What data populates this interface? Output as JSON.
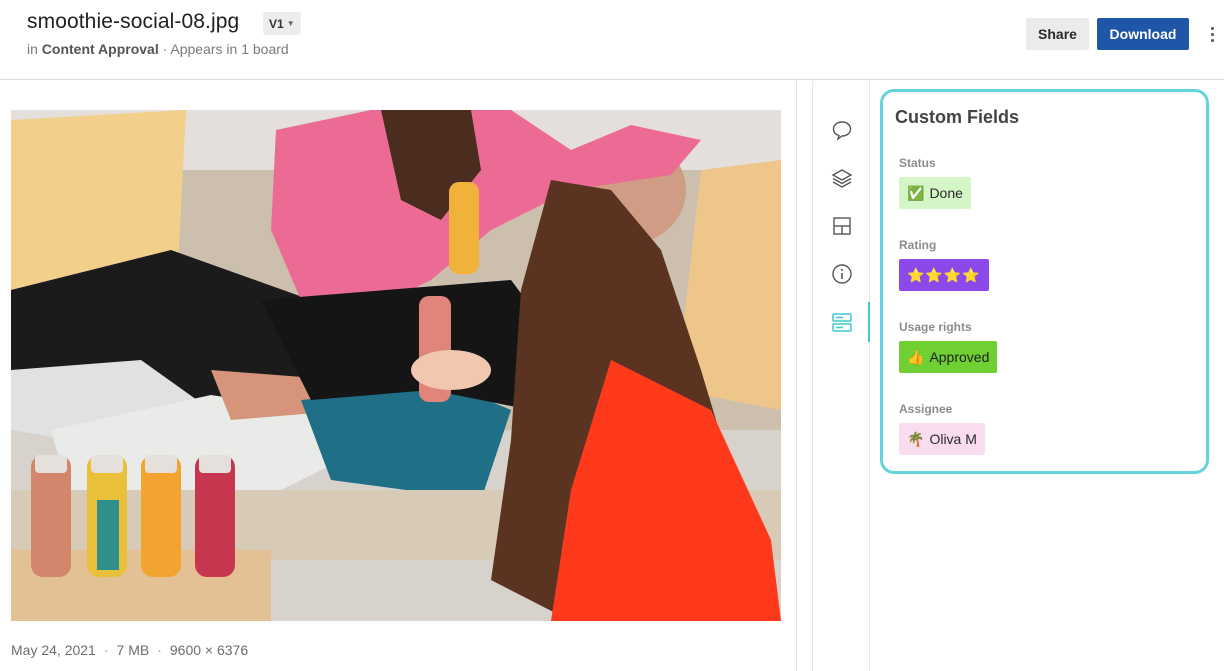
{
  "file": {
    "name": "smoothie-social-08.jpg",
    "version": "V1",
    "location_prefix": "in",
    "location": "Content Approval",
    "boards_note": "· Appears in 1 board"
  },
  "actions": {
    "share_label": "Share",
    "download_label": "Download"
  },
  "meta": {
    "date": "May 24, 2021",
    "size": "7 MB",
    "dimensions": "9600 × 6376",
    "separator": "·"
  },
  "rail": {
    "icons": [
      "comment-icon",
      "layers-icon",
      "layout-icon",
      "info-icon",
      "custom-fields-icon"
    ],
    "active": "custom-fields-icon"
  },
  "custom_fields": {
    "title": "Custom Fields",
    "status": {
      "label": "Status",
      "emoji": "✅",
      "value": "Done",
      "bg": "#d4f5c6"
    },
    "rating": {
      "label": "Rating",
      "value": "⭐⭐⭐⭐",
      "bg": "#8a49e8"
    },
    "usage": {
      "label": "Usage rights",
      "emoji": "👍",
      "value": "Approved",
      "bg": "#6fcf33"
    },
    "assignee": {
      "label": "Assignee",
      "emoji": "🌴",
      "value": "Oliva M",
      "bg": "#fadcf0"
    }
  },
  "colors": {
    "accent": "#62d5dc",
    "primary_button": "#1f56a8"
  }
}
